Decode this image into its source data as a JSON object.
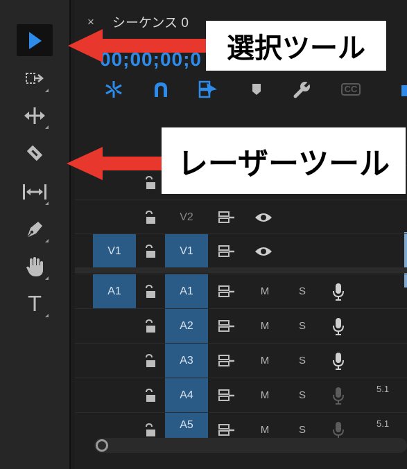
{
  "tools": [
    {
      "name": "selection-tool",
      "icon": "selection-arrow-icon",
      "active": true
    },
    {
      "name": "track-select-tool",
      "icon": "track-select-icon"
    },
    {
      "name": "ripple-edit-tool",
      "icon": "ripple-edit-icon"
    },
    {
      "name": "razor-tool",
      "icon": "razor-blade-icon"
    },
    {
      "name": "slip-tool",
      "icon": "slip-icon"
    },
    {
      "name": "pen-tool",
      "icon": "pen-icon"
    },
    {
      "name": "hand-tool",
      "icon": "hand-icon"
    },
    {
      "name": "type-tool",
      "icon": "type-icon",
      "label": "T"
    }
  ],
  "sequence": {
    "close_label": "×",
    "tab_title": "シーケンス 0",
    "timecode": "00;00;00;0"
  },
  "toolbar": {
    "items": [
      "snap-icon",
      "magnet-icon",
      "linked-selection-icon",
      "marker-icon",
      "wrench-icon",
      "captions-icon"
    ],
    "captions_label": "CC"
  },
  "tracks": {
    "v2": {
      "name": "V2"
    },
    "v1": {
      "source": "V1",
      "name": "V1"
    },
    "a1": {
      "source": "A1",
      "name": "A1",
      "mute": "M",
      "solo": "S"
    },
    "a2": {
      "name": "A2",
      "mute": "M",
      "solo": "S"
    },
    "a3": {
      "name": "A3",
      "mute": "M",
      "solo": "S"
    },
    "a4": {
      "name": "A4",
      "mute": "M",
      "solo": "S",
      "channels": "5.1"
    },
    "a5": {
      "name": "A5",
      "mute": "M",
      "solo": "S",
      "channels": "5.1"
    }
  },
  "annotations": {
    "selection_tool": "選択ツール",
    "razor_tool": "レーザーツール"
  },
  "colors": {
    "accent": "#2d8ceb",
    "track_target": "#2a5a86",
    "arrow": "#e8372c",
    "panel": "#262626"
  }
}
